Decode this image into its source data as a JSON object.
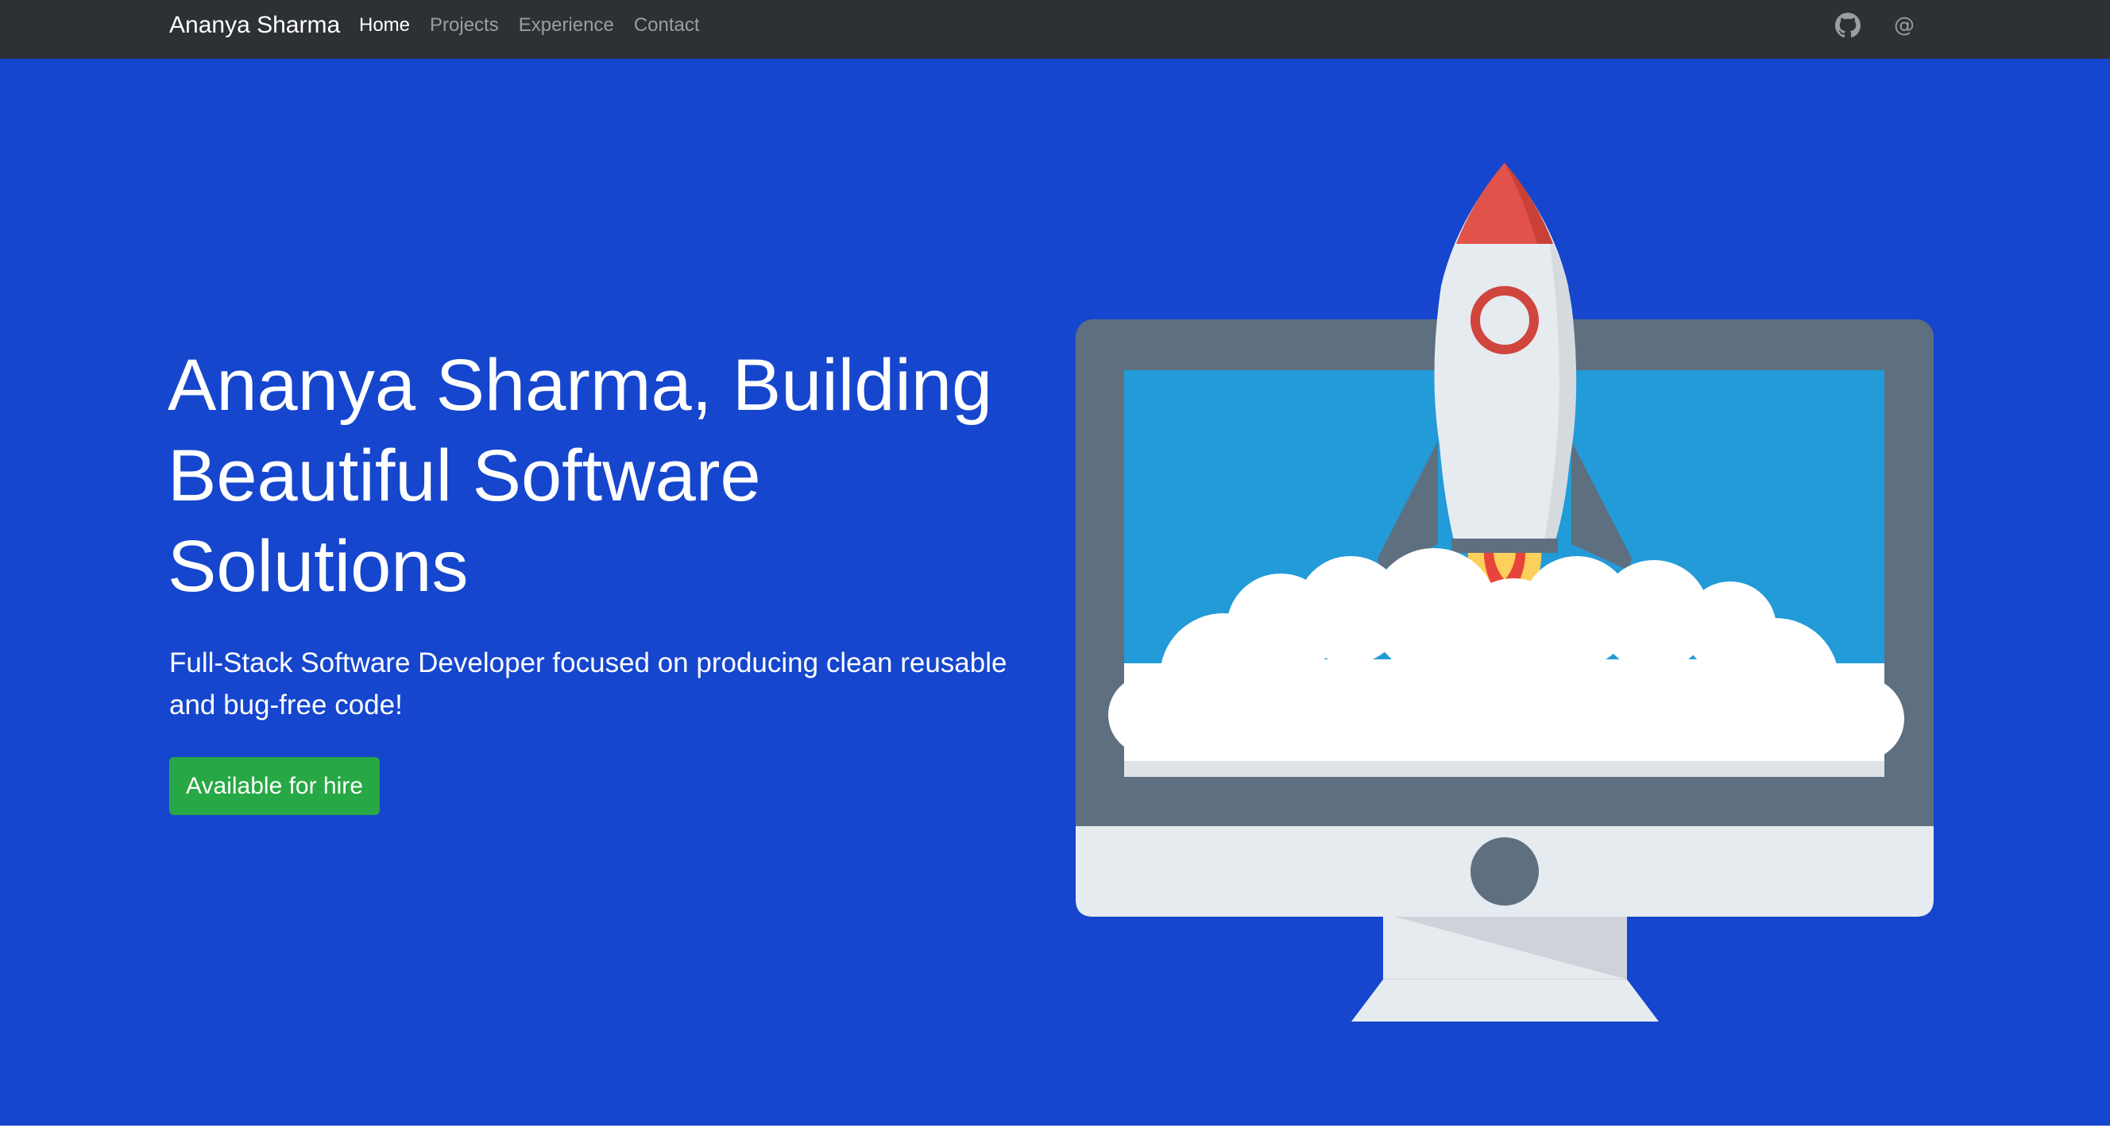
{
  "navbar": {
    "brand": "Ananya Sharma",
    "links": [
      {
        "label": "Home",
        "active": true
      },
      {
        "label": "Projects",
        "active": false
      },
      {
        "label": "Experience",
        "active": false
      },
      {
        "label": "Contact",
        "active": false
      }
    ],
    "icons": [
      "github-icon",
      "at-sign-icon"
    ],
    "background_color": "#2d3035"
  },
  "hero": {
    "headline": "Ananya Sharma, Building Beautiful Software Solutions",
    "subheadline": "Full-Stack Software Developer focused on producing clean reusable and bug-free code!",
    "cta_label": "Available for hire",
    "background_color": "#1546cd",
    "cta_color": "#28a745",
    "illustration": "rocket-launching-from-monitor-illustration"
  }
}
